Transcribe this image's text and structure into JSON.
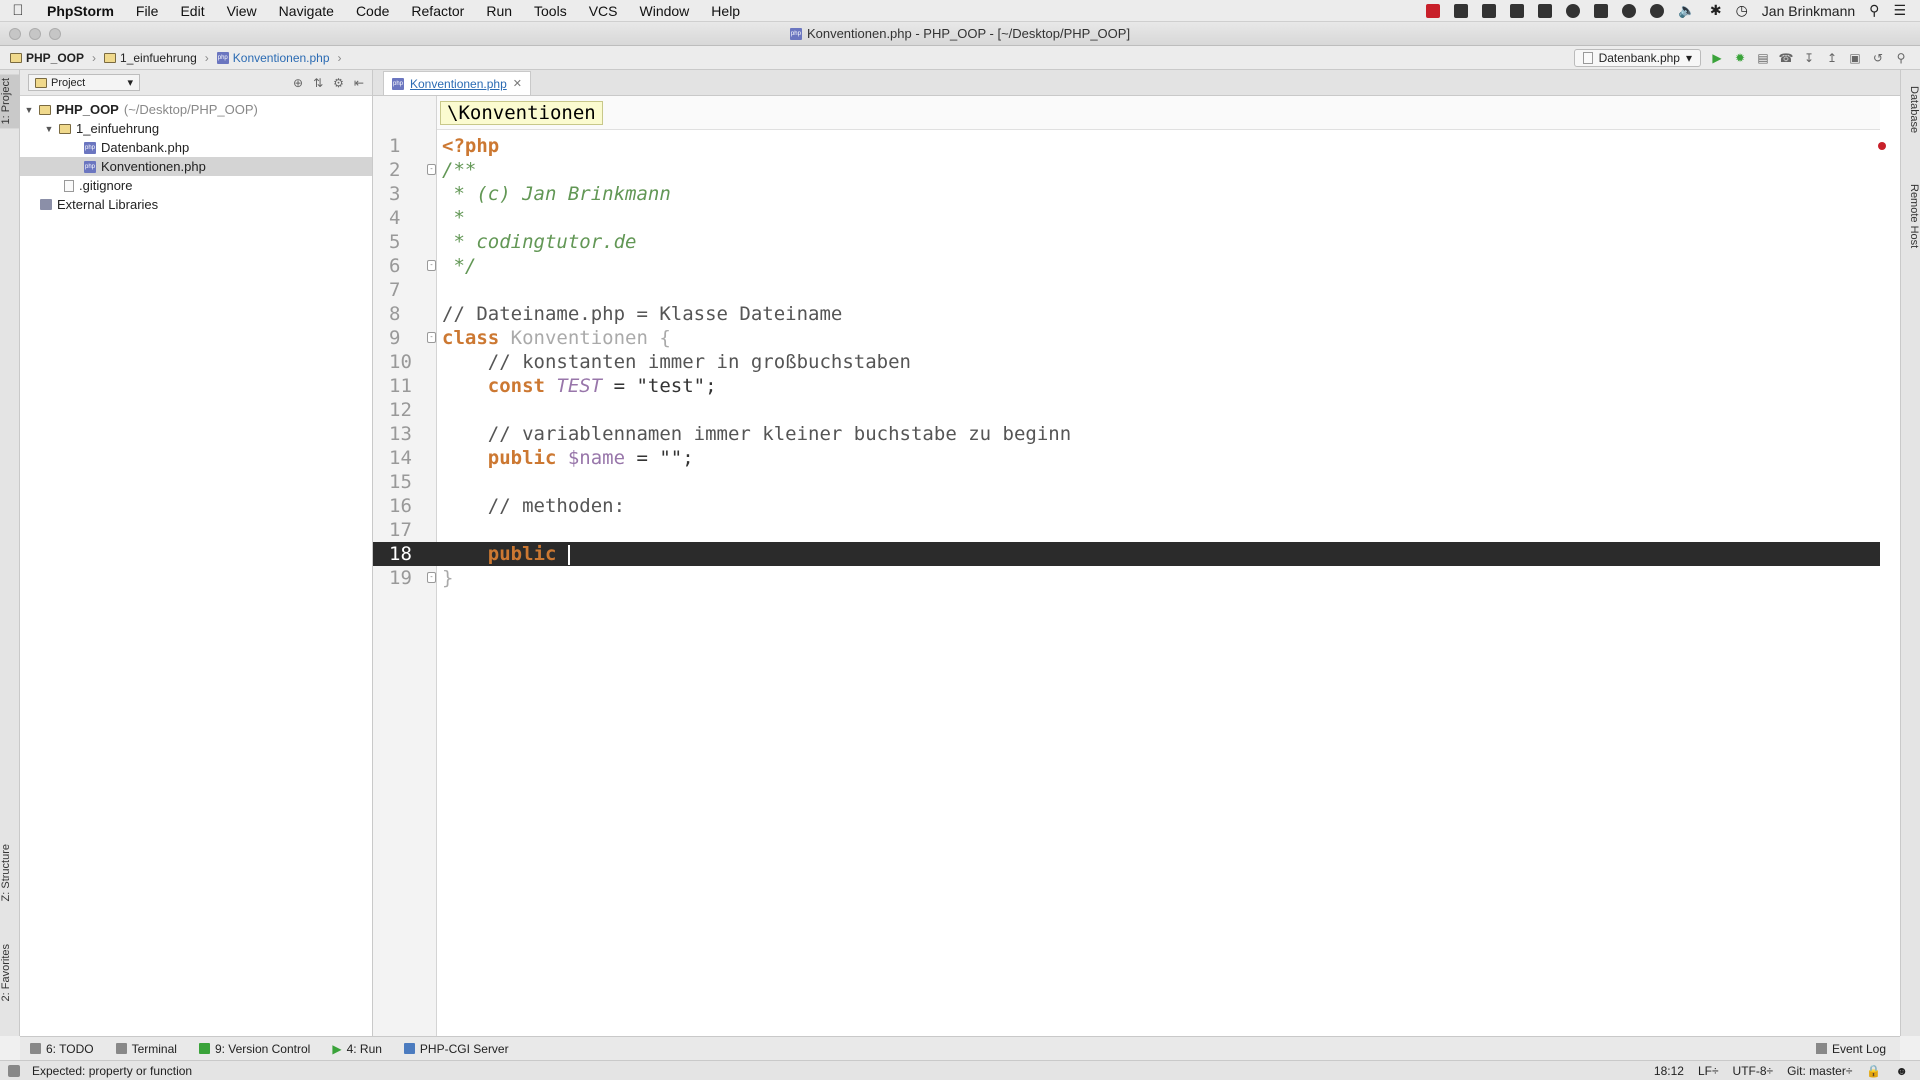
{
  "menubar": {
    "app_name": "PhpStorm",
    "items": [
      "File",
      "Edit",
      "View",
      "Navigate",
      "Code",
      "Refactor",
      "Run",
      "Tools",
      "VCS",
      "Window",
      "Help"
    ],
    "user": "Jan Brinkmann"
  },
  "window": {
    "title": "Konventionen.php - PHP_OOP - [~/Desktop/PHP_OOP]"
  },
  "breadcrumb": {
    "items": [
      "PHP_OOP",
      "1_einfuehrung",
      "Konventionen.php"
    ]
  },
  "toolbar": {
    "run_config": "Datenbank.php"
  },
  "left_tabs": {
    "project": "1: Project",
    "structure": "Z: Structure",
    "favorites": "2: Favorites"
  },
  "right_tabs": {
    "database": "Database",
    "remote_host": "Remote Host"
  },
  "project_panel": {
    "selector": "Project",
    "tree": {
      "root": {
        "name": "PHP_OOP",
        "path": "(~/Desktop/PHP_OOP)"
      },
      "folder": "1_einfuehrung",
      "file1": "Datenbank.php",
      "file2": "Konventionen.php",
      "gitignore": ".gitignore",
      "libraries": "External Libraries"
    }
  },
  "editor": {
    "tab_name": "Konventionen.php",
    "scope_hint": "\\Konventionen",
    "line_numbers": [
      "1",
      "2",
      "3",
      "4",
      "5",
      "6",
      "7",
      "8",
      "9",
      "10",
      "11",
      "12",
      "13",
      "14",
      "15",
      "16",
      "17",
      "18",
      "19"
    ],
    "code": {
      "l1": "<?php",
      "l2": "/**",
      "l3": " * (c) Jan Brinkmann",
      "l4": " *",
      "l5": " * codingtutor.de",
      "l6": " */",
      "l8": "// Dateiname.php = Klasse Dateiname",
      "l9_kw": "class",
      "l9_name": " Konventionen {",
      "l10": "    // konstanten immer in großbuchstaben",
      "l11_kw": "    const",
      "l11_name": " TEST",
      "l11_rest": " = \"test\";",
      "l13": "    // variablennamen immer kleiner buchstabe zu beginn",
      "l14_kw": "    public",
      "l14_var": " $name",
      "l14_rest": " = \"\";",
      "l16": "    // methoden:",
      "l18_kw": "    public",
      "l19": "}"
    }
  },
  "bottom_tabs": {
    "todo": "6: TODO",
    "terminal": "Terminal",
    "vcs": "9: Version Control",
    "run": "4: Run",
    "cgi": "PHP-CGI Server",
    "event_log": "Event Log"
  },
  "status": {
    "message": "Expected: property or function",
    "position": "18:12",
    "line_sep": "LF÷",
    "encoding": "UTF-8÷",
    "git": "Git: master÷"
  }
}
